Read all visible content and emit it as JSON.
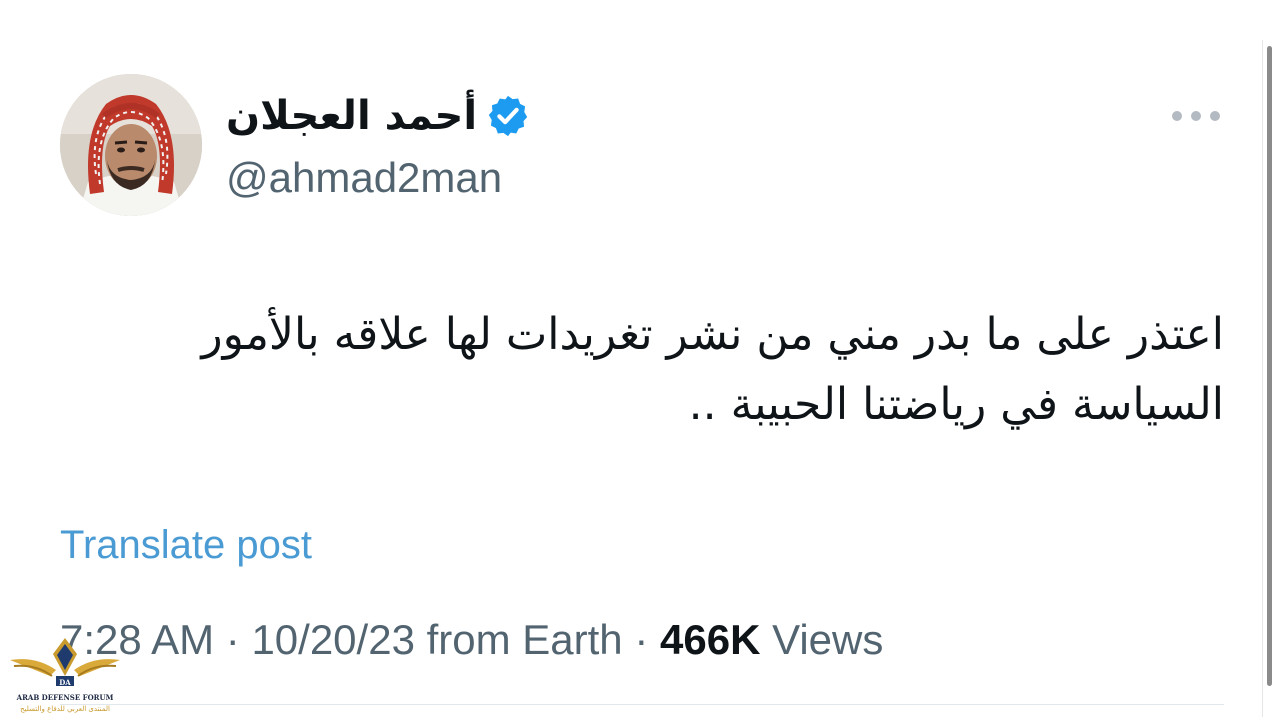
{
  "author": {
    "display_name": "أحمد العجلان",
    "handle": "@ahmad2man",
    "verified": true,
    "avatar_icon": "profile-photo"
  },
  "tweet": {
    "text_line_1": "اعتذر على ما بدر مني من نشر تغريدات لها علاقه بالأمور",
    "text_line_2": "السياسة في رياضتنا الحبيبة .."
  },
  "translate": {
    "label": "Translate post"
  },
  "meta": {
    "time": "7:28 AM",
    "sep1": " · ",
    "date": "10/20/23",
    "source": " from Earth",
    "sep2": " · ",
    "views_count": "466K",
    "views_label": " Views"
  },
  "colors": {
    "verified": "#1d9bf0",
    "link": "#4a9bd4",
    "secondary_text": "#536471",
    "primary_text": "#0f1419"
  },
  "watermark": {
    "logo_icon": "eagle-emblem",
    "title": "ARAB DEFENSE FORUM",
    "subtitle": "المنتدى العربي للدفاع والتسليح"
  }
}
